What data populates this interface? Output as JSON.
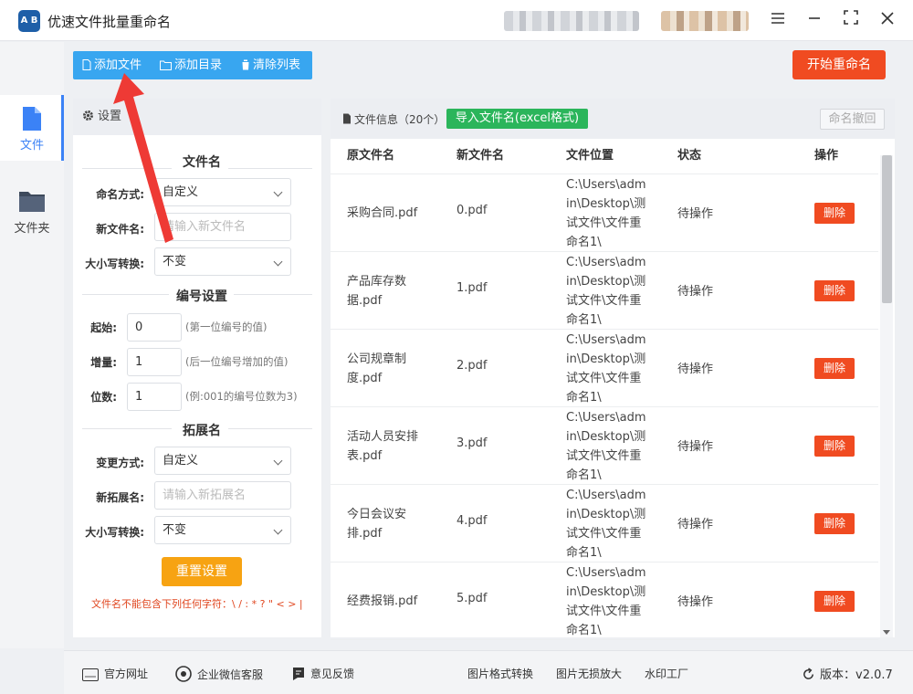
{
  "app": {
    "logo_text": "A B",
    "title": "优速文件批量重命名"
  },
  "sidebar": {
    "items": [
      {
        "label": "文件"
      },
      {
        "label": "文件夹"
      }
    ]
  },
  "toolbar": {
    "add_file": "添加文件",
    "add_dir": "添加目录",
    "clear_list": "清除列表",
    "start": "开始重命名"
  },
  "settings": {
    "title": "设置",
    "filename_section": "文件名",
    "naming_mode_label": "命名方式:",
    "naming_mode_value": "自定义",
    "new_name_label": "新文件名:",
    "new_name_placeholder": "请输入新文件名",
    "case_label": "大小写转换:",
    "case_value": "不变",
    "numbering_section": "编号设置",
    "start_label": "起始:",
    "start_value": "0",
    "start_hint": "(第一位编号的值)",
    "step_label": "增量:",
    "step_value": "1",
    "step_hint": "(后一位编号增加的值)",
    "digits_label": "位数:",
    "digits_value": "1",
    "digits_hint": "(例:001的编号位数为3)",
    "ext_section": "拓展名",
    "ext_mode_label": "变更方式:",
    "ext_mode_value": "自定义",
    "new_ext_label": "新拓展名:",
    "new_ext_placeholder": "请输入新拓展名",
    "ext_case_label": "大小写转换:",
    "ext_case_value": "不变",
    "reset": "重置设置",
    "warning": "文件名不能包含下列任何字符：\\ / : * ? \" < > |"
  },
  "files": {
    "info_label": "文件信息（20个）",
    "import_label": "导入文件名(excel格式)",
    "undo_label": "命名撤回",
    "columns": [
      "原文件名",
      "新文件名",
      "文件位置",
      "状态",
      "操作"
    ],
    "rows": [
      {
        "orig": "采购合同.pdf",
        "new": "0.pdf",
        "loc": "C:\\Users\\admin\\Desktop\\测试文件\\文件重命名1\\",
        "status": "待操作",
        "action": "删除"
      },
      {
        "orig": "产品库存数据.pdf",
        "new": "1.pdf",
        "loc": "C:\\Users\\admin\\Desktop\\测试文件\\文件重命名1\\",
        "status": "待操作",
        "action": "删除"
      },
      {
        "orig": "公司规章制度.pdf",
        "new": "2.pdf",
        "loc": "C:\\Users\\admin\\Desktop\\测试文件\\文件重命名1\\",
        "status": "待操作",
        "action": "删除"
      },
      {
        "orig": "活动人员安排表.pdf",
        "new": "3.pdf",
        "loc": "C:\\Users\\admin\\Desktop\\测试文件\\文件重命名1\\",
        "status": "待操作",
        "action": "删除"
      },
      {
        "orig": "今日会议安排.pdf",
        "new": "4.pdf",
        "loc": "C:\\Users\\admin\\Desktop\\测试文件\\文件重命名1\\",
        "status": "待操作",
        "action": "删除"
      },
      {
        "orig": "经费报销.pdf",
        "new": "5.pdf",
        "loc": "C:\\Users\\admin\\Desktop\\测试文件\\文件重命名1\\",
        "status": "待操作",
        "action": "删除"
      }
    ]
  },
  "footer": {
    "website": "官方网址",
    "wechat": "企业微信客服",
    "feedback": "意见反馈",
    "img_convert": "图片格式转换",
    "img_enlarge": "图片无损放大",
    "watermark": "水印工厂",
    "version_label": "版本：",
    "version": "v2.0.7"
  },
  "colors": {
    "primary": "#38a6f0",
    "danger": "#f04b21",
    "success": "#2bb55b",
    "warning": "#f7a312",
    "active": "#3b82f6"
  }
}
